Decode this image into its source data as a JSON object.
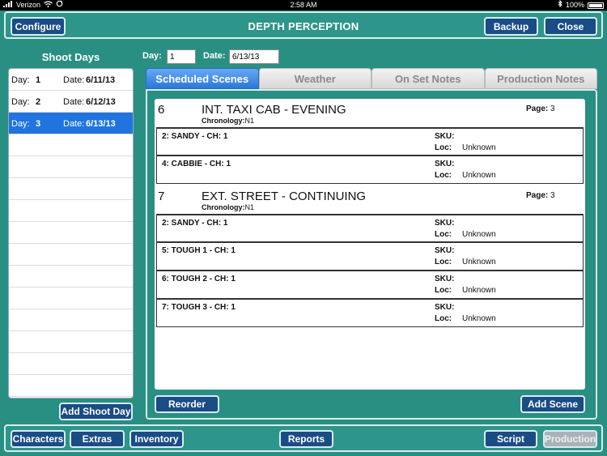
{
  "status": {
    "carrier": "Verizon",
    "time": "2:58 AM",
    "battery": "100%"
  },
  "header": {
    "title": "DEPTH PERCEPTION",
    "configure": "Configure",
    "backup": "Backup",
    "close": "Close"
  },
  "shoot_days": {
    "title": "Shoot Days",
    "day_label": "Day:",
    "date_label": "Date:",
    "items": [
      {
        "day": "1",
        "date": "6/11/13"
      },
      {
        "day": "2",
        "date": "6/12/13"
      },
      {
        "day": "3",
        "date": "6/13/13"
      }
    ],
    "add_button": "Add Shoot Day"
  },
  "fields": {
    "day_label": "Day:",
    "day_value": "1",
    "date_label": "Date:",
    "date_value": "6/13/13"
  },
  "tabs": [
    "Scheduled Scenes",
    "Weather",
    "On Set Notes",
    "Production Notes"
  ],
  "labels": {
    "chronology": "Chronology:",
    "page": "Page:",
    "sku": "SKU:",
    "loc": "Loc:"
  },
  "scenes": [
    {
      "number": "6",
      "heading": "INT. TAXI CAB - EVENING",
      "chronology": "N1",
      "page": "3",
      "characters": [
        {
          "name": "2: SANDY - CH: 1",
          "loc": "Unknown"
        },
        {
          "name": "4: CABBIE - CH: 1",
          "loc": "Unknown"
        }
      ]
    },
    {
      "number": "7",
      "heading": "EXT. STREET - CONTINUING",
      "chronology": "N1",
      "page": "3",
      "characters": [
        {
          "name": "2: SANDY - CH: 1",
          "loc": "Unknown"
        },
        {
          "name": "5: TOUGH 1 - CH: 1",
          "loc": "Unknown"
        },
        {
          "name": "6: TOUGH 2 - CH: 1",
          "loc": "Unknown"
        },
        {
          "name": "7: TOUGH 3 - CH: 1",
          "loc": "Unknown"
        }
      ]
    }
  ],
  "panel_buttons": {
    "reorder": "Reorder",
    "add_scene": "Add Scene"
  },
  "bottom": {
    "characters": "Characters",
    "extras": "Extras",
    "inventory": "Inventory",
    "reports": "Reports",
    "script": "Script",
    "production": "Production"
  }
}
